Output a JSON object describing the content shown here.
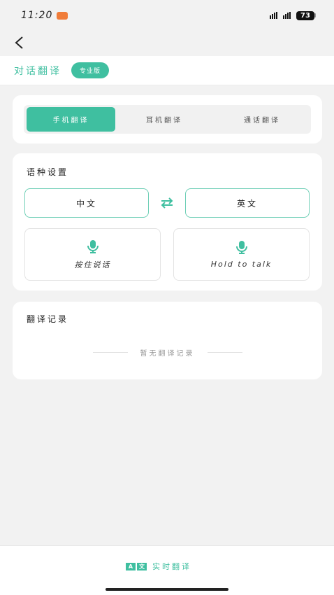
{
  "status_bar": {
    "time": "11:20",
    "battery": "73"
  },
  "header": {
    "title": "对话翻译",
    "badge": "专业版"
  },
  "mode_tabs": [
    {
      "label": "手机翻译",
      "active": true
    },
    {
      "label": "耳机翻译",
      "active": false
    },
    {
      "label": "通话翻译",
      "active": false
    }
  ],
  "language_settings": {
    "title": "语种设置",
    "source_language": "中文",
    "target_language": "英文",
    "talk_buttons": [
      {
        "label": "按住说话",
        "icon": "microphone-icon"
      },
      {
        "label": "Hold to talk",
        "icon": "microphone-icon"
      }
    ]
  },
  "records": {
    "title": "翻译记录",
    "empty_text": "暂无翻译记录"
  },
  "bottom": {
    "realtime_label": "实时翻译",
    "icon": "az-translate-icon",
    "icon_letters": [
      "A",
      "文"
    ]
  },
  "colors": {
    "accent": "#3fbfa0"
  }
}
